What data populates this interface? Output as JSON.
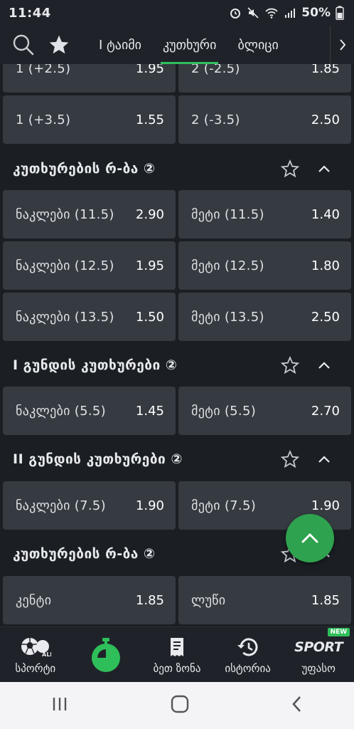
{
  "status": {
    "time": "11:44",
    "battery": "50%"
  },
  "tabs": [
    {
      "label": "I ტაიმი"
    },
    {
      "label": "კუთხური"
    },
    {
      "label": "ბლიცი"
    }
  ],
  "markets": [
    {
      "title": "",
      "rows": [
        [
          {
            "label": "1 (+2.5)",
            "odd": "1.95"
          },
          {
            "label": "2 (-2.5)",
            "odd": "1.85"
          }
        ],
        [
          {
            "label": "1 (+3.5)",
            "odd": "1.55"
          },
          {
            "label": "2 (-3.5)",
            "odd": "2.50"
          }
        ]
      ]
    },
    {
      "title": "კუთხურების რ-ბა ②",
      "rows": [
        [
          {
            "label": "ნაკლები (11.5)",
            "odd": "2.90"
          },
          {
            "label": "მეტი (11.5)",
            "odd": "1.40"
          }
        ],
        [
          {
            "label": "ნაკლები (12.5)",
            "odd": "1.95"
          },
          {
            "label": "მეტი (12.5)",
            "odd": "1.80"
          }
        ],
        [
          {
            "label": "ნაკლები (13.5)",
            "odd": "1.50"
          },
          {
            "label": "მეტი (13.5)",
            "odd": "2.50"
          }
        ]
      ]
    },
    {
      "title": "I გუნდის კუთხურები ②",
      "rows": [
        [
          {
            "label": "ნაკლები (5.5)",
            "odd": "1.45"
          },
          {
            "label": "მეტი (5.5)",
            "odd": "2.70"
          }
        ]
      ]
    },
    {
      "title": "II გუნდის კუთხურები ②",
      "rows": [
        [
          {
            "label": "ნაკლები (7.5)",
            "odd": "1.90"
          },
          {
            "label": "მეტი (7.5)",
            "odd": "1.90"
          }
        ]
      ]
    },
    {
      "title": "კუთხურების რ-ბა ②",
      "rows": [
        [
          {
            "label": "კენტი",
            "odd": "1.85"
          },
          {
            "label": "ლუწი",
            "odd": "1.85"
          }
        ]
      ]
    }
  ],
  "bottom_nav": [
    {
      "label": "სპორტი",
      "icon": "soccer-all-icon"
    },
    {
      "label": "",
      "icon": "stopwatch-icon"
    },
    {
      "label": "ბეთ ზონა",
      "icon": "betslip-icon"
    },
    {
      "label": "ისტორია",
      "icon": "history-icon"
    },
    {
      "label": "უფასო",
      "icon": "sport-logo-icon",
      "badge": "NEW",
      "logo_text": "SPORT"
    }
  ],
  "colors": {
    "accent": "#2fbf5a",
    "background": "#1b1f24",
    "card": "#363b42"
  }
}
